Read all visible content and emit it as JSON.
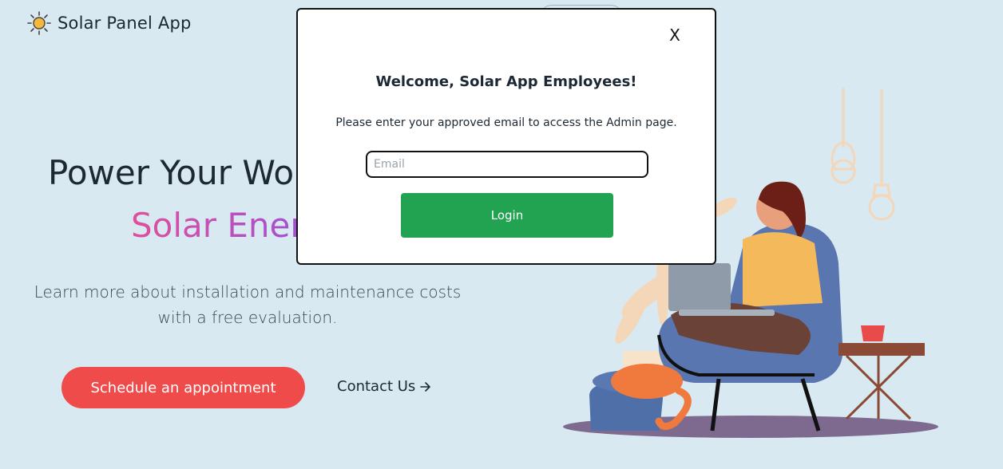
{
  "header": {
    "brand_name": "Solar Panel App",
    "brand_icon": "sun-icon"
  },
  "hero": {
    "title": "Power Your World with",
    "title_visible": "Power Your Wo",
    "accent": "Solar Energy",
    "accent_visible": "Solar Ener",
    "description": "Learn more about installation and maintenance costs with a free evaluation.",
    "primary_button": "Schedule an appointment",
    "contact_link": "Contact Us",
    "contact_icon": "arrow-right-icon"
  },
  "modal": {
    "close_label": "X",
    "title": "Welcome, Solar App Employees!",
    "message": "Please enter your approved email to access the Admin page.",
    "email_placeholder": "Email",
    "email_value": "",
    "login_label": "Login"
  },
  "colors": {
    "background": "#d9e9f1",
    "primary_button": "#ef4b4b",
    "login_button": "#21a351",
    "accent_gradient_start": "#e0509a",
    "accent_gradient_end": "#a24fd6"
  }
}
